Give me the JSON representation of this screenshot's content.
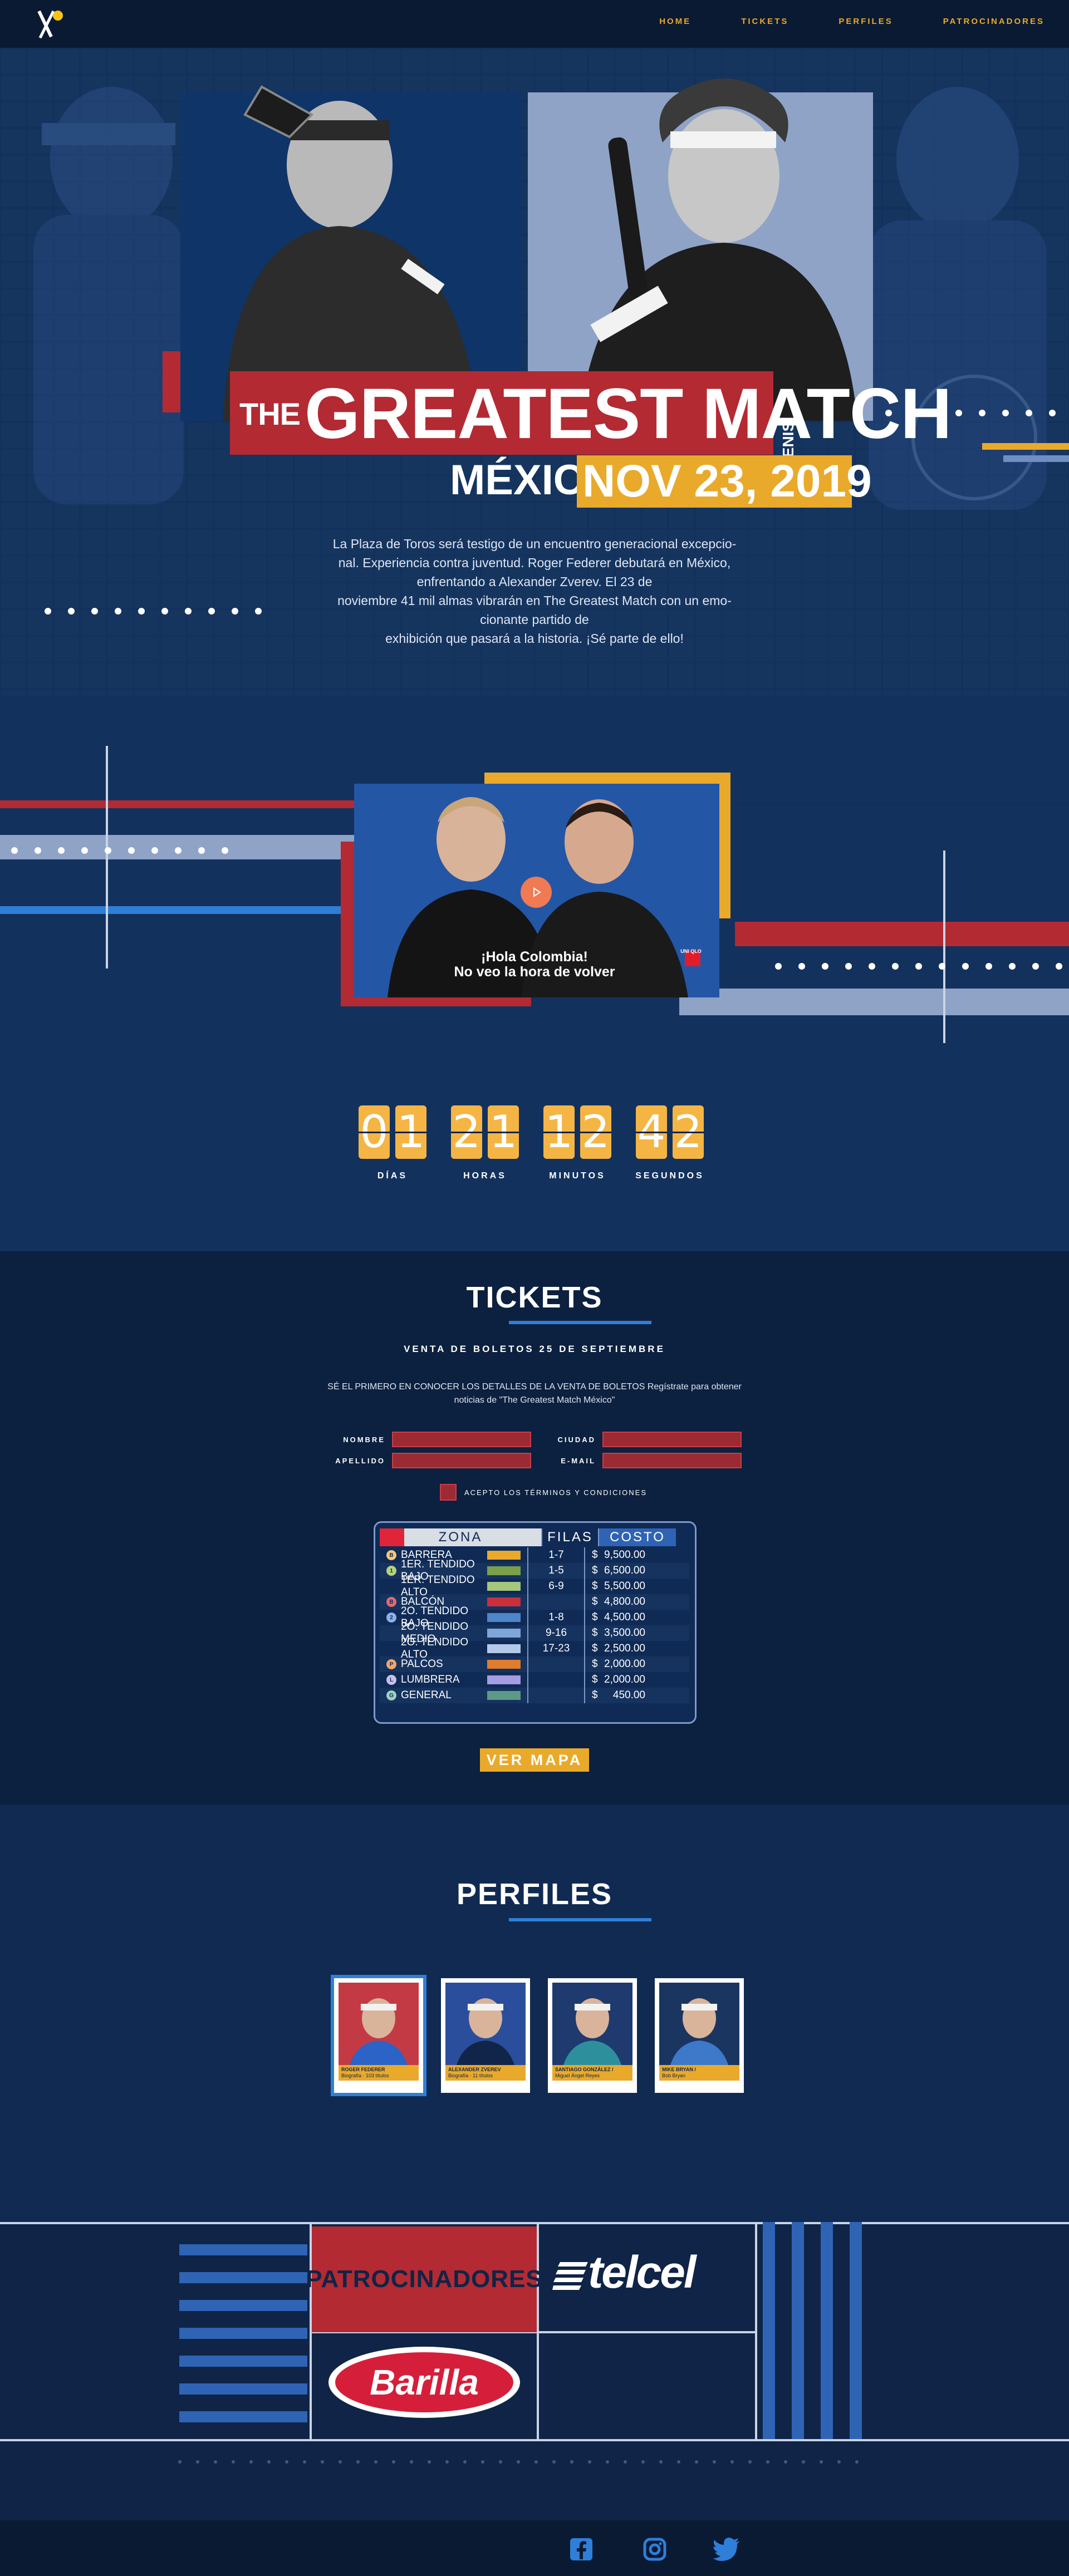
{
  "nav": {
    "items": [
      {
        "label": "HOME"
      },
      {
        "label": "TICKETS"
      },
      {
        "label": "PERFILES"
      },
      {
        "label": "PATROCINADORES"
      }
    ]
  },
  "hero": {
    "title_the": "THE",
    "title_main": "GREATEST MATCH",
    "brand": "MEXTENIS",
    "city": "MÉXICO",
    "date": "NOV 23, 2019",
    "intro_lines": [
      "La Plaza de Toros será testigo de un encuentro generacional excepcio-",
      "nal. Experiencia contra juventud. Roger Federer debutará en México,",
      "enfrentando a Alexander Zverev. El 23 de",
      "noviembre 41 mil almas vibrarán en The Greatest Match con un emo-",
      "cionante partido de",
      "exhibición que pasará a la historia. ¡Sé parte de ello!"
    ]
  },
  "video": {
    "caption_line1": "¡Hola Colombia!",
    "caption_line2": "No veo la hora de volver",
    "badge": "UNI QLO"
  },
  "countdown": [
    {
      "digits": [
        "0",
        "1"
      ],
      "label": "DÍAS"
    },
    {
      "digits": [
        "2",
        "1"
      ],
      "label": "HORAS"
    },
    {
      "digits": [
        "1",
        "2"
      ],
      "label": "MINUTOS"
    },
    {
      "digits": [
        "4",
        "2"
      ],
      "label": "SEGUNDOS"
    }
  ],
  "tickets": {
    "title": "TICKETS",
    "subtitle": "VENTA DE BOLETOS 25 DE SEPTIEMBRE",
    "note_line1": "SÉ EL PRIMERO EN CONOCER LOS DETALLES DE LA VENTA DE BOLETOS Regístrate para obtener",
    "note_line2": "noticias de \"The Greatest Match México\"",
    "fields": {
      "nombre": "NOMBRE",
      "apellido": "APELLIDO",
      "ciudad": "CIUDAD",
      "email": "E-MAIL"
    },
    "terms": "ACEPTO LOS TÉRMINOS Y CONDICIONES",
    "table": {
      "headers": {
        "zona": "ZONA",
        "filas": "FILAS",
        "costo": "COSTO"
      },
      "rows": [
        {
          "dot": "B",
          "dot_color": "#f2c879",
          "name": "BARRERA",
          "swatch": "#e9a92a",
          "filas": "1-7",
          "currency": "$",
          "cost": "9,500.00"
        },
        {
          "dot": "1",
          "dot_color": "#b6d47a",
          "name": "1ER. TENDIDO BAJO",
          "swatch": "#7aa04a",
          "filas": "1-5",
          "currency": "$",
          "cost": "6,500.00"
        },
        {
          "dot": "",
          "dot_color": "",
          "name": "1ER. TENDIDO ALTO",
          "swatch": "#a6c67d",
          "filas": "6-9",
          "currency": "$",
          "cost": "5,500.00"
        },
        {
          "dot": "B",
          "dot_color": "#e06a73",
          "name": "BALCÓN",
          "swatch": "#c8303c",
          "filas": "",
          "currency": "$",
          "cost": "4,800.00"
        },
        {
          "dot": "2",
          "dot_color": "#8ab2e6",
          "name": "2O. TENDIDO BAJO",
          "swatch": "#4f86c9",
          "filas": "1-8",
          "currency": "$",
          "cost": "4,500.00"
        },
        {
          "dot": "",
          "dot_color": "",
          "name": "2O. TENDIDO MEDIO",
          "swatch": "#7ea6d8",
          "filas": "9-16",
          "currency": "$",
          "cost": "3,500.00"
        },
        {
          "dot": "",
          "dot_color": "",
          "name": "2O. TENDIDO ALTO",
          "swatch": "#b3cbe9",
          "filas": "17-23",
          "currency": "$",
          "cost": "2,500.00"
        },
        {
          "dot": "P",
          "dot_color": "#f2a66a",
          "name": "PALCOS",
          "swatch": "#e27c2f",
          "filas": "",
          "currency": "$",
          "cost": "2,000.00"
        },
        {
          "dot": "L",
          "dot_color": "#c9c0ef",
          "name": "LUMBRERA",
          "swatch": "#a79be2",
          "filas": "",
          "currency": "$",
          "cost": "2,000.00"
        },
        {
          "dot": "G",
          "dot_color": "#9ed0c0",
          "name": "GENERAL",
          "swatch": "#5c9a86",
          "filas": "",
          "currency": "$",
          "cost": "450.00"
        }
      ]
    },
    "map_button": "VER MAPA"
  },
  "profiles": {
    "title": "PERFILES",
    "cards": [
      {
        "name": "ROGER FEDERER",
        "sub": "Biografía · 103 títulos",
        "bg": "#c33a45",
        "shirt": "#2b63c7"
      },
      {
        "name": "ALEXANDER ZVEREV",
        "sub": "Biografía · 11 títulos",
        "bg": "#2a4e9c",
        "shirt": "#11254a"
      },
      {
        "name": "SANTIAGO GONZÁLEZ /",
        "sub": "Miguel Ángel Reyes",
        "bg": "#1e3a6e",
        "shirt": "#2e8f9c"
      },
      {
        "name": "MIKE BRYAN /",
        "sub": "Bob Bryan",
        "bg": "#1b3561",
        "shirt": "#3d79c8"
      }
    ]
  },
  "sponsors": {
    "title": "PATROCINADORES",
    "telcel": "telcel",
    "barilla": "Barilla"
  },
  "colors": {
    "accent_gold": "#e9a92a",
    "accent_red": "#b32a33",
    "accent_blue": "#2f7fd9",
    "navy": "#0f2446"
  },
  "footer": {
    "icons": [
      "facebook-icon",
      "instagram-icon",
      "twitter-icon"
    ]
  }
}
